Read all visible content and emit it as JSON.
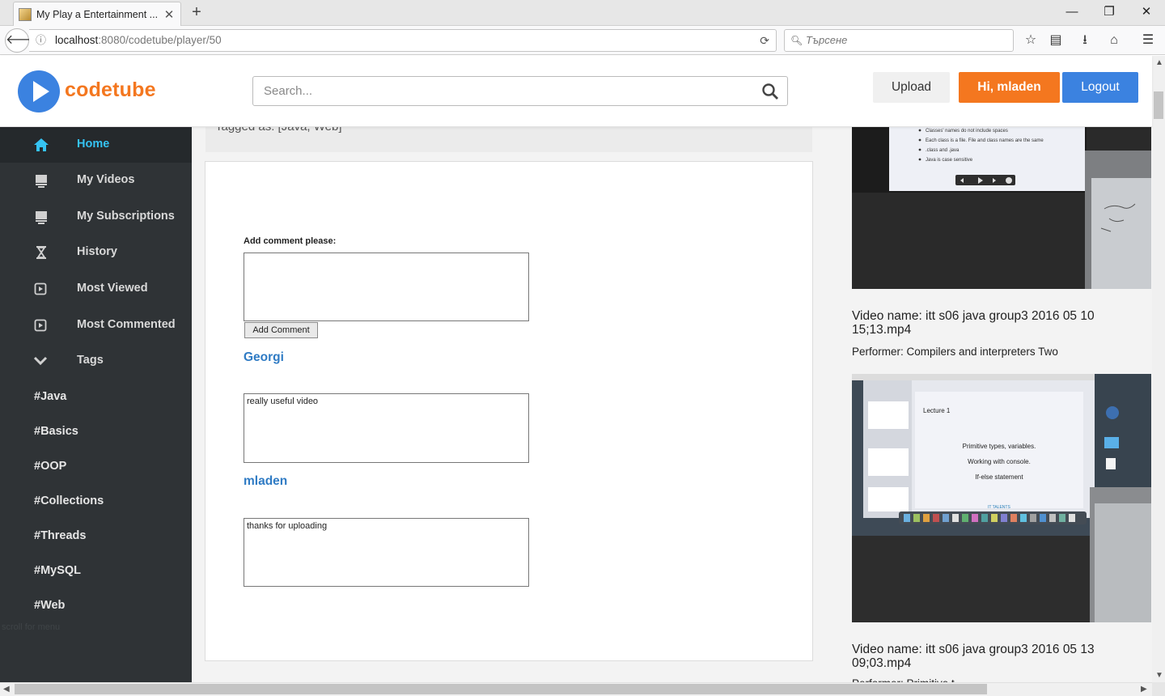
{
  "browser": {
    "tab_title": "My Play a Entertainment ...",
    "url_host": "localhost",
    "url_rest": ":8080/codetube/player/50",
    "search_placeholder": "Търсене"
  },
  "header": {
    "logo_text": "codetube",
    "search_placeholder": "Search...",
    "upload_label": "Upload",
    "greeting_label": "Hi, mladen",
    "logout_label": "Logout"
  },
  "sidebar": {
    "items": [
      {
        "label": "Home",
        "icon": "home-icon"
      },
      {
        "label": "My Videos",
        "icon": "monitor-icon"
      },
      {
        "label": "My Subscriptions",
        "icon": "monitor-icon"
      },
      {
        "label": "History",
        "icon": "hourglass-icon"
      },
      {
        "label": "Most Viewed",
        "icon": "play-square-icon"
      },
      {
        "label": "Most Commented",
        "icon": "play-square-icon"
      },
      {
        "label": "Tags",
        "icon": "chevron-down-icon"
      }
    ],
    "tags": [
      "#Java",
      "#Basics",
      "#OOP",
      "#Collections",
      "#Threads",
      "#MySQL",
      "#Web"
    ],
    "ghost_text": "scroll for menu"
  },
  "main": {
    "tagged_text": "Tagged as: [Java, Web]",
    "add_comment_label": "Add comment please:",
    "add_comment_button": "Add Comment",
    "comments": [
      {
        "author": "Georgi",
        "text": "really useful video"
      },
      {
        "author": "mladen",
        "text": "thanks for uploading"
      }
    ]
  },
  "related": [
    {
      "slide_bullets": [
        "Classes' names do not include spaces",
        "Each class is a file. File and class names are the same",
        ".class and .java",
        "Java is case sensitive"
      ]
    },
    {
      "name": "Video name: itt s06 java group3 2016 05 10 15;13.mp4",
      "performer": "Performer: Compilers and interpreters Two",
      "slide_title": "Lecture 1",
      "slide_lines": [
        "Primitive types, variables.",
        "Working with console.",
        "If-else statement"
      ],
      "slide_brand": "IT TALENTS"
    },
    {
      "name": "Video name: itt s06 java group3 2016 05 13 09;03.mp4",
      "performer": "Performer: Primitive t..."
    }
  ],
  "colors": {
    "brand_orange": "#f4771f",
    "brand_blue": "#3b82e0",
    "sidebar_bg": "#2f3336",
    "active_text": "#35c3f3",
    "author_link": "#2f7bc4"
  }
}
